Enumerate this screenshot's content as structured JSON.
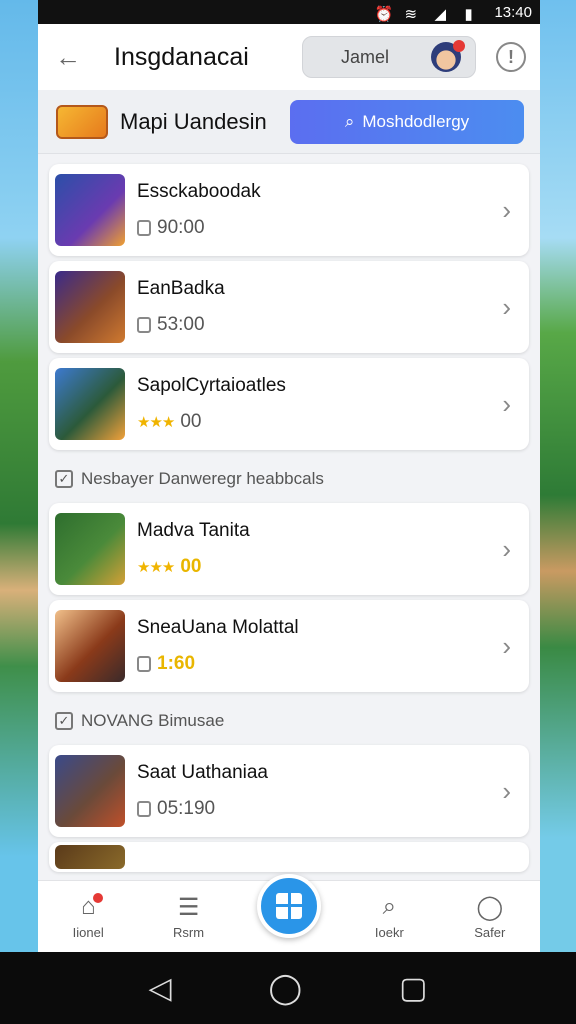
{
  "status_bar": {
    "time": "13:40"
  },
  "header": {
    "title": "Insgdanacai",
    "user_name": "Jamel",
    "back_icon": "arrow-left-icon",
    "info_icon": "info-icon"
  },
  "banner": {
    "title": "Mapi Uandesin",
    "search_label": "Moshdodlergy",
    "search_icon": "search-icon"
  },
  "games_top": [
    {
      "title": "Essckaboodak",
      "sub": "90:00",
      "sub_type": "lock"
    },
    {
      "title": "EanBadka",
      "sub": "53:00",
      "sub_type": "lock"
    },
    {
      "title": "SapolCyrtaioatles",
      "sub": "00",
      "sub_type": "stars"
    }
  ],
  "section_1": {
    "label": "Nesbayer Danweregr heabbcals"
  },
  "games_mid": [
    {
      "title": "Madva Tanita",
      "sub": "00",
      "sub_type": "stars-gold"
    },
    {
      "title": "SneaUana Molattal",
      "sub": "1:60",
      "sub_type": "lock-gold"
    }
  ],
  "section_2": {
    "label": "NOVANG Bimusae"
  },
  "games_bottom": [
    {
      "title": "Saat Uathaniaa",
      "sub": "05:190",
      "sub_type": "lock"
    }
  ],
  "bottom_nav": {
    "home": "Iionel",
    "feed": "Rsrm",
    "search": "Ioekr",
    "profile": "Safer"
  },
  "colors": {
    "accent": "#2a95e8",
    "search_gradient_start": "#5b6ef0",
    "search_gradient_end": "#4c8df0",
    "badge_red": "#e53935",
    "star_gold": "#f0b400"
  }
}
